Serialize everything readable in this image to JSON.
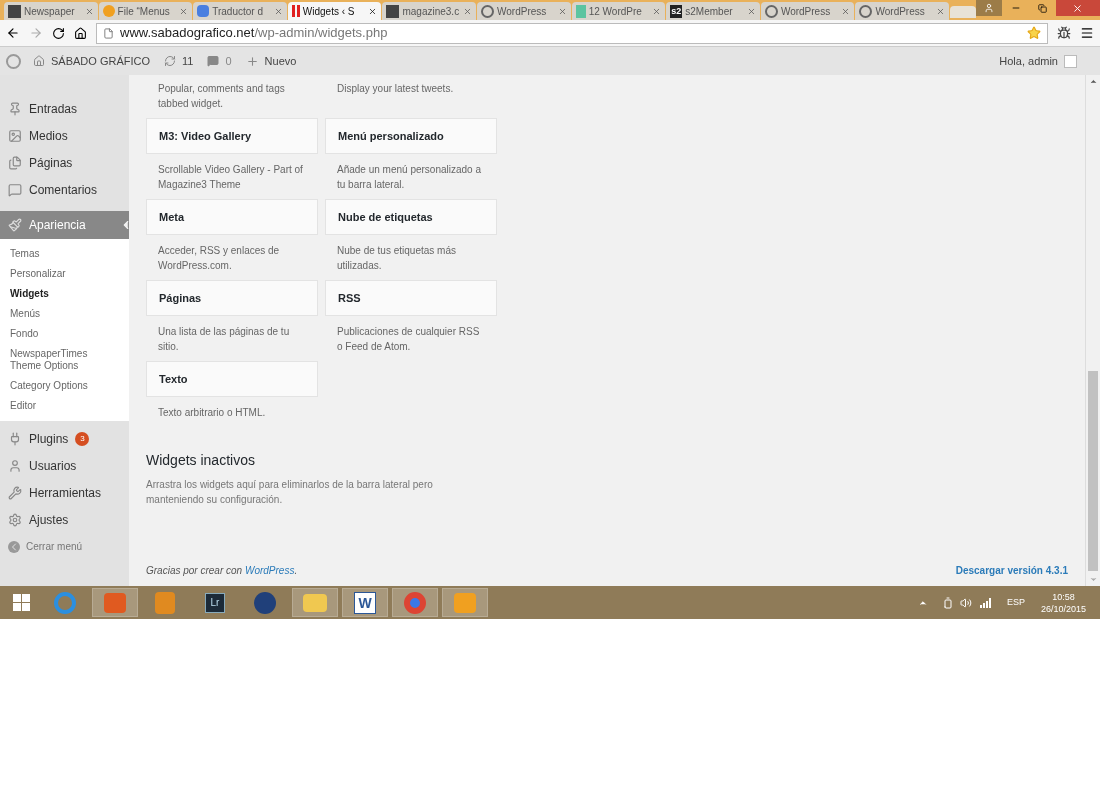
{
  "tabs": [
    {
      "title": "Newspaper",
      "selected": false
    },
    {
      "title": "File “Menus",
      "selected": false
    },
    {
      "title": "Traductor d",
      "selected": false
    },
    {
      "title": "Widgets ‹ S",
      "selected": true
    },
    {
      "title": "magazine3.c",
      "selected": false
    },
    {
      "title": "WordPress",
      "selected": false
    },
    {
      "title": "12 WordPre",
      "selected": false
    },
    {
      "title": "s2Member",
      "selected": false
    },
    {
      "title": "WordPress",
      "selected": false
    },
    {
      "title": "WordPress",
      "selected": false
    }
  ],
  "s2_label": "s2",
  "address": {
    "host": "www.sabadografico.net",
    "path": "/wp-admin/widgets.php"
  },
  "admin_bar": {
    "site": "SÁBADO GRÁFICO",
    "updates": "11",
    "comments": "0",
    "new": "Nuevo",
    "greeting": "Hola, admin"
  },
  "sidebar": [
    {
      "label": "Entradas",
      "selected": false
    },
    {
      "label": "Medios",
      "selected": false
    },
    {
      "label": "Páginas",
      "selected": false
    },
    {
      "label": "Comentarios",
      "selected": false
    },
    {
      "label": "Apariencia",
      "selected": true,
      "children": [
        {
          "label": "Temas",
          "selected": false
        },
        {
          "label": "Personalizar",
          "selected": false
        },
        {
          "label": "Widgets",
          "selected": true
        },
        {
          "label": "Menús",
          "selected": false
        },
        {
          "label": "Fondo",
          "selected": false
        },
        {
          "label": "NewspaperTimes Theme Options",
          "selected": false
        },
        {
          "label": "Category Options",
          "selected": false
        },
        {
          "label": "Editor",
          "selected": false
        }
      ]
    },
    {
      "label": "Plugins",
      "selected": false,
      "badge": "3"
    },
    {
      "label": "Usuarios",
      "selected": false
    },
    {
      "label": "Herramientas",
      "selected": false
    },
    {
      "label": "Ajustes",
      "selected": false
    }
  ],
  "collapse": "Cerrar menú",
  "top_descriptions": [
    "Popular, comments and tags tabbed widget.",
    "Display your latest tweets."
  ],
  "widgets": [
    {
      "title": "M3: Video Gallery",
      "description": "Scrollable Video Gallery - Part of Magazine3 Theme"
    },
    {
      "title": "Menú personalizado",
      "description": "Añade un menú personalizado a tu barra lateral."
    },
    {
      "title": "Meta",
      "description": "Acceder, RSS y enlaces de WordPress.com."
    },
    {
      "title": "Nube de etiquetas",
      "description": "Nube de tus etiquetas más utilizadas."
    },
    {
      "title": "Páginas",
      "description": "Una lista de las páginas de tu sitio."
    },
    {
      "title": "RSS",
      "description": "Publicaciones de cualquier RSS o Feed de Atom."
    },
    {
      "title": "Texto",
      "description": "Texto arbitrario o HTML."
    }
  ],
  "inactive": {
    "title": "Widgets inactivos",
    "text": "Arrastra los widgets aquí para eliminarlos de la barra lateral pero manteniendo su configuración."
  },
  "footer": {
    "thanks": "Gracias por crear con",
    "link": "WordPress",
    "period": ".",
    "version": "Descargar versión 4.3.1"
  },
  "taskbar": [
    {
      "active": false
    },
    {
      "active": true
    },
    {
      "active": false
    },
    {
      "active": false
    },
    {
      "active": false
    },
    {
      "active": true
    },
    {
      "active": true
    },
    {
      "active": true
    },
    {
      "active": true
    }
  ],
  "lr_label": "Lr",
  "word_label": "W",
  "tray": {
    "lang": "ESP",
    "time": "10:58",
    "date": "26/10/2015"
  }
}
